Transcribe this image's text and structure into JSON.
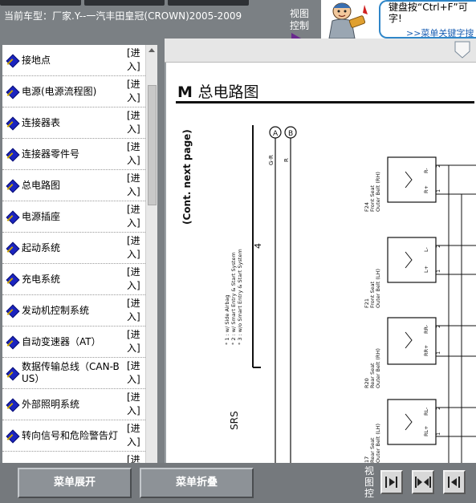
{
  "header": {
    "vehicle_label": "当前车型：厂家.Y--一汽丰田皇冠(CROWN)2005-2009",
    "view_control": "视图控制",
    "hint_text": "键盘按“Ctrl+F”可\n字!",
    "hint_link": ">>菜单关键字搜"
  },
  "menu": {
    "items": [
      {
        "label": "接地点",
        "enter": "[进入]"
      },
      {
        "label": "电源(电源流程图)",
        "enter": "[进入]"
      },
      {
        "label": "连接器表",
        "enter": "[进入]"
      },
      {
        "label": "连接器零件号",
        "enter": "[进入]"
      },
      {
        "label": "总电路图",
        "enter": "[进入]"
      },
      {
        "label": "电源插座",
        "enter": "[进入]"
      },
      {
        "label": "起动系统",
        "enter": "[进入]"
      },
      {
        "label": "充电系统",
        "enter": "[进入]"
      },
      {
        "label": "发动机控制系统",
        "enter": "[进入]"
      },
      {
        "label": "自动变速器（AT）",
        "enter": "[进入]"
      },
      {
        "label": "数据传输总线（CAN-BUS）",
        "enter": "[进入]"
      },
      {
        "label": "外部照明系统",
        "enter": "[进入]"
      },
      {
        "label": "转向信号和危险警告灯",
        "enter": "[进入]"
      },
      {
        "label": "",
        "enter": "[进"
      }
    ]
  },
  "document": {
    "title_letter": "M",
    "title_text": "总电路图",
    "continued": "(Cont.  next page)",
    "notes": [
      "* 1 : w/ Side Airbag",
      "* 2 : w/ Smart Entry & Start System",
      "* 3 : w/o Smart Entry & Start System"
    ],
    "note_number": "4",
    "system_label": "SRS",
    "connectors": [
      "A",
      "B"
    ],
    "wire_labels": [
      "G-R",
      "R"
    ],
    "components": [
      {
        "code": "F24",
        "name1": "Front Seat",
        "name2": "Outer Belt (RH)",
        "pins": [
          "R-",
          "R+"
        ],
        "pin_nums": [
          "2",
          "1"
        ]
      },
      {
        "code": "F21",
        "name1": "Front Seat",
        "name2": "Outer Belt (LH)",
        "pins": [
          "L-",
          "L+"
        ],
        "pin_nums": [
          "2",
          "1"
        ]
      },
      {
        "code": "R20",
        "name1": "Rear Seat",
        "name2": "Outer Belt (RH)",
        "pins": [
          "RR-",
          "RR+"
        ],
        "pin_nums": [
          "2",
          "1"
        ]
      },
      {
        "code": "17",
        "name1": "Rear Seat",
        "name2": "Outer Belt (LH)",
        "pins": [
          "RL-",
          "RL+"
        ],
        "pin_nums": [
          "2",
          "1"
        ]
      }
    ]
  },
  "footer": {
    "expand_label": "菜单展开",
    "collapse_label": "菜单折叠",
    "view_control": "视图控",
    "nav_right_icon": "arrow-right-icon",
    "nav_both_icon": "arrows-inward-icon",
    "nav_left_icon": "arrow-left-icon"
  },
  "colors": {
    "panel_gray": "#7b8084",
    "menu_diamond": "#1b24c0",
    "hint_border": "#2f86c8",
    "link": "#1a5fb4"
  }
}
